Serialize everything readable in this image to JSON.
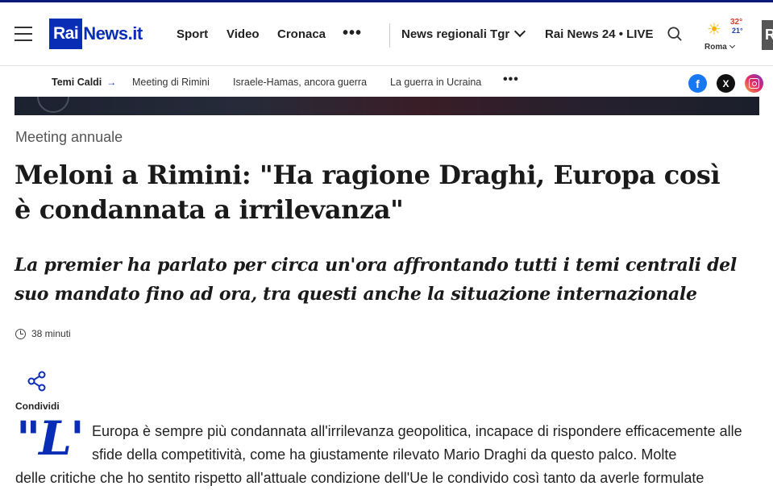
{
  "brand": {
    "logo_rai": "Rai",
    "logo_news": "News.it"
  },
  "header": {
    "nav": [
      "Sport",
      "Video",
      "Cronaca"
    ],
    "more": "•••",
    "regional": "News regionali Tgr",
    "live": "Rai News 24 • LIVE",
    "weather": {
      "temp_high": "32°",
      "temp_low": "21°",
      "city": "Roma"
    },
    "rai_box": "R"
  },
  "subnav": {
    "hot_label": "Temi Caldi",
    "items": [
      "Meeting di Rimini",
      "Israele-Hamas, ancora guerra",
      "La guerra in Ucraina"
    ],
    "more": "•••",
    "social": {
      "facebook": "f",
      "x": "X"
    }
  },
  "article": {
    "kicker": "Meeting annuale",
    "title": "Meloni a Rimini: \"Ha ragione Draghi, Europa così è condannata a irrilevanza\"",
    "subtitle": "La premier ha parlato per circa un'ora affrontando tutti i temi centrali del suo mandato fino ad ora, tra questi anche la situazione internazionale",
    "time": "38 minuti",
    "share_label": "Condividi",
    "dropcap": "\"L'",
    "body_line1": "Europa è sempre più condannata all'irrilevanza geopolitica, incapace di rispondere efficacemente alle sfide della competitività, come ha giustamente rilevato Mario Draghi da questo palco. Molte",
    "body_line2": "delle critiche che ho sentito rispetto all'attuale condizione dell'Ue le condivido così tanto da averle formulate"
  },
  "colors": {
    "brand_blue": "#0a2db5",
    "facebook": "#1877f2"
  },
  "icons": [
    "menu-icon",
    "search-icon",
    "sun-icon",
    "arrow-right-icon",
    "chevron-down-icon",
    "clock-icon",
    "share-icon",
    "facebook-icon",
    "x-icon",
    "instagram-icon"
  ]
}
